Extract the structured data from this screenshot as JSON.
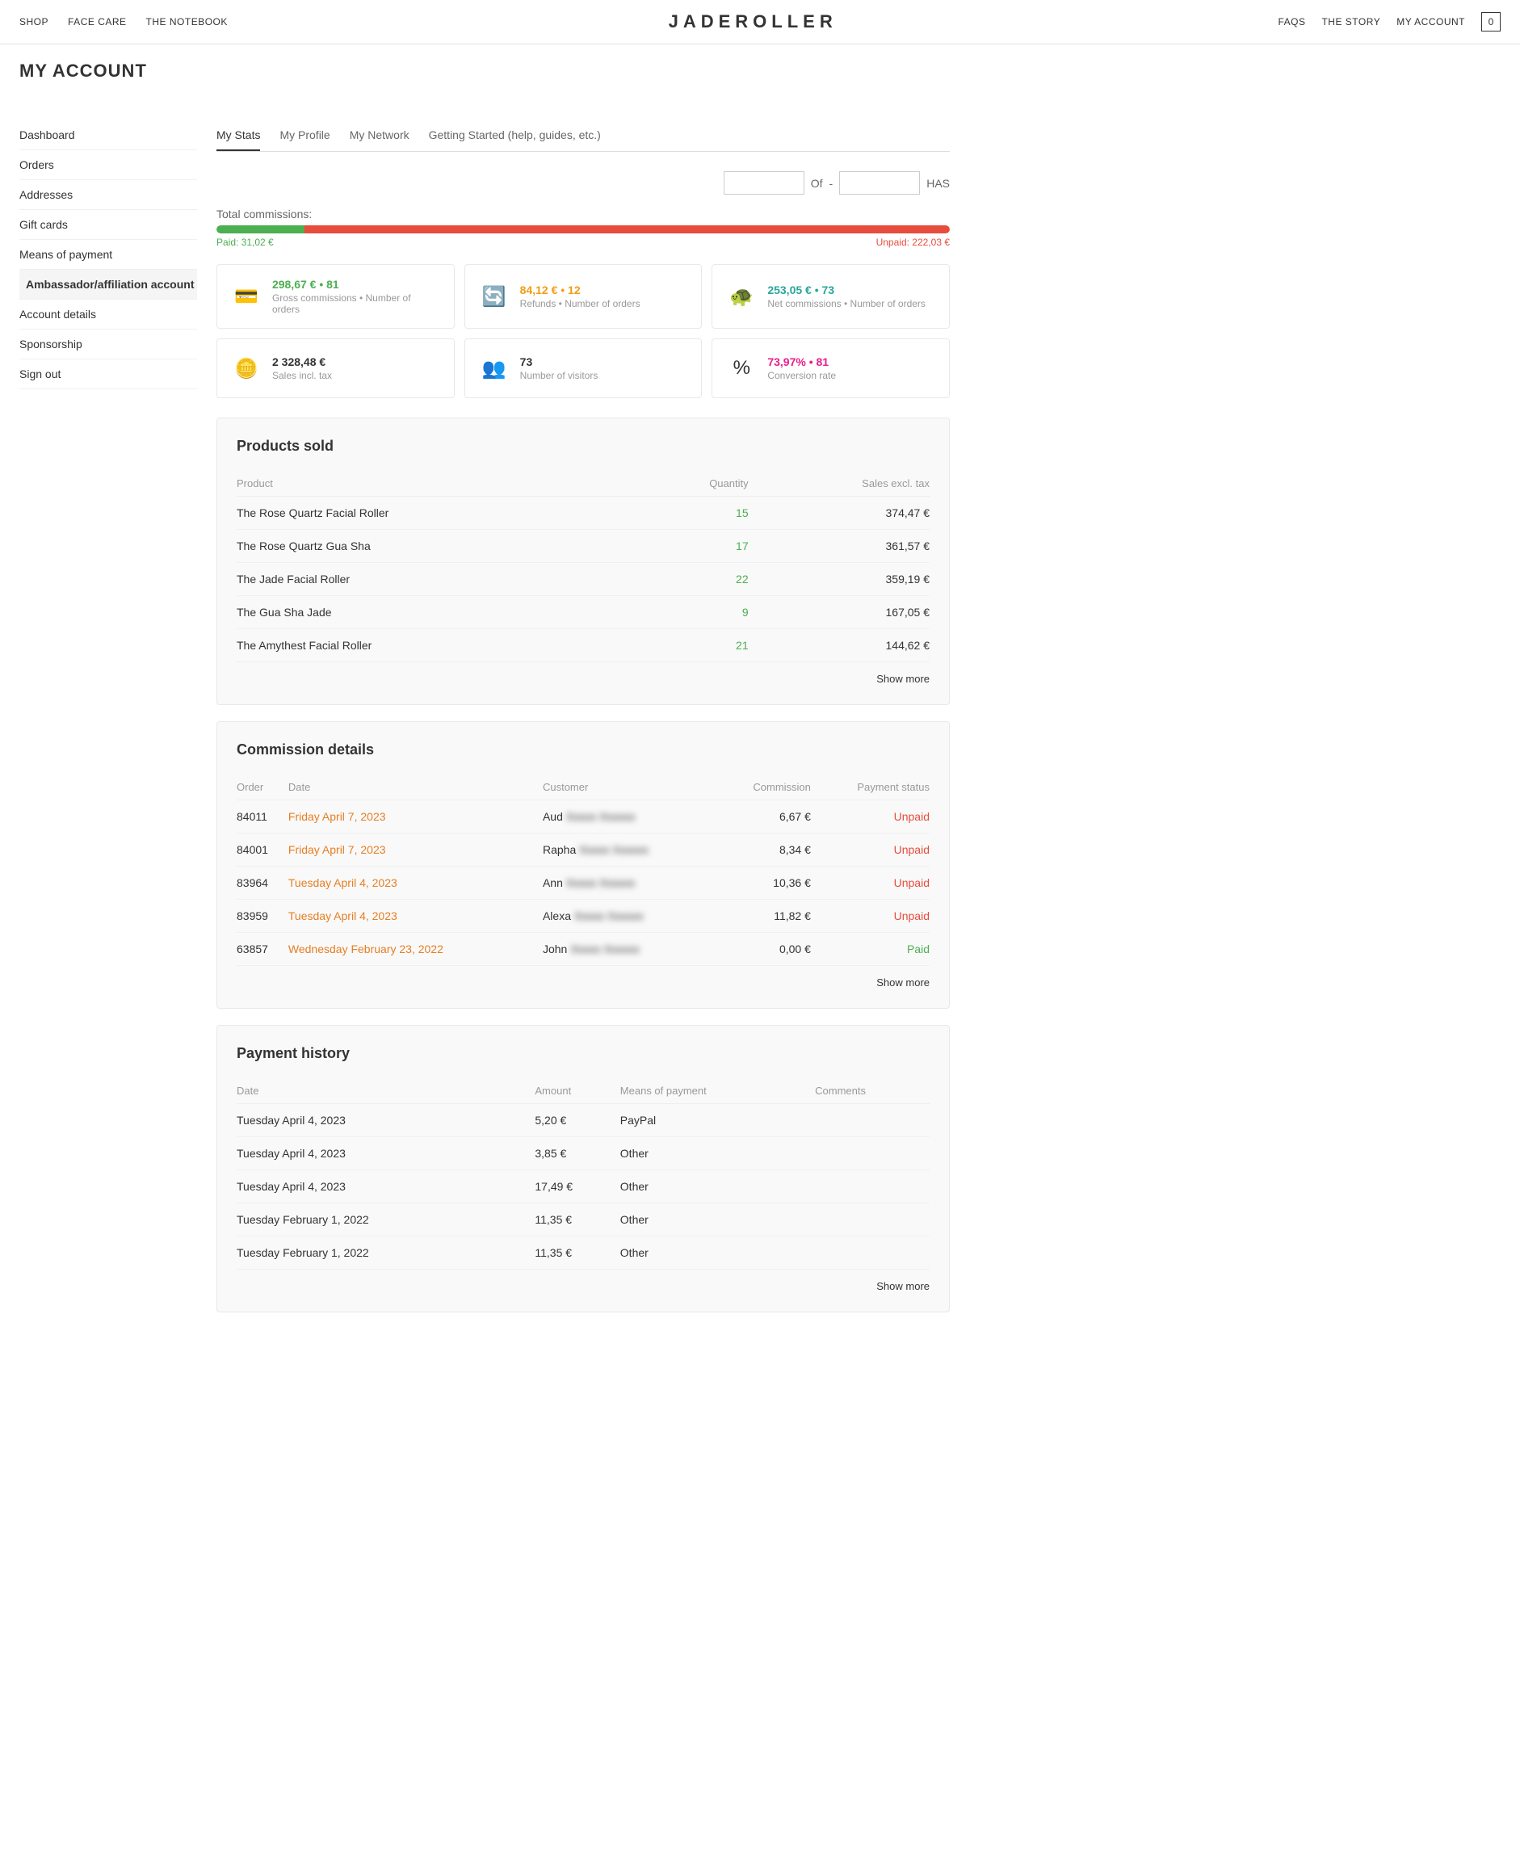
{
  "brand": "JADEROLLER",
  "topnav": {
    "left": [
      "SHOP",
      "FACE CARE",
      "THE NOTEBOOK"
    ],
    "right": [
      "FAQS",
      "THE STORY",
      "MY ACCOUNT"
    ],
    "cart_count": "0"
  },
  "page_title": "MY ACCOUNT",
  "sidebar": {
    "items": [
      {
        "label": "Dashboard",
        "active": false,
        "id": "dashboard"
      },
      {
        "label": "Orders",
        "active": false,
        "id": "orders"
      },
      {
        "label": "Addresses",
        "active": false,
        "id": "addresses"
      },
      {
        "label": "Gift cards",
        "active": false,
        "id": "gift-cards"
      },
      {
        "label": "Means of payment",
        "active": false,
        "id": "means-of-payment"
      },
      {
        "label": "Ambassador/affiliation account",
        "active": true,
        "id": "ambassador"
      },
      {
        "label": "Account details",
        "active": false,
        "id": "account-details"
      },
      {
        "label": "Sponsorship",
        "active": false,
        "id": "sponsorship"
      },
      {
        "label": "Sign out",
        "active": false,
        "id": "sign-out"
      }
    ]
  },
  "tabs": [
    {
      "label": "My Stats",
      "active": true
    },
    {
      "label": "My Profile",
      "active": false
    },
    {
      "label": "My Network",
      "active": false
    },
    {
      "label": "Getting Started (help, guides, etc.)",
      "active": false
    }
  ],
  "filter": {
    "of_label": "Of",
    "dash": "-",
    "has_label": "HAS"
  },
  "commissions": {
    "label": "Total commissions:",
    "paid_label": "Paid: 31,02 €",
    "unpaid_label": "Unpaid: 222,03 €",
    "paid_percent": 12,
    "unpaid_percent": 88
  },
  "stat_cards": [
    {
      "icon": "💳",
      "value": "298,67 € • 81",
      "value_class": "green",
      "label": "Gross commissions • Number of orders"
    },
    {
      "icon": "🔄",
      "value": "84,12 € • 12",
      "value_class": "orange",
      "label": "Refunds • Number of orders"
    },
    {
      "icon": "🐢",
      "value": "253,05 € • 73",
      "value_class": "blue-green",
      "label": "Net commissions • Number of orders"
    },
    {
      "icon": "🪙",
      "value": "2 328,48 €",
      "value_class": "",
      "label": "Sales incl. tax"
    },
    {
      "icon": "👥",
      "value": "73",
      "value_class": "",
      "label": "Number of visitors"
    },
    {
      "icon": "%",
      "value": "73,97% • 81",
      "value_class": "pink",
      "label": "Conversion rate"
    }
  ],
  "products_sold": {
    "title": "Products sold",
    "headers": [
      "Product",
      "Quantity",
      "Sales excl. tax"
    ],
    "rows": [
      {
        "product": "The Rose Quartz Facial Roller",
        "quantity": "15",
        "sales": "374,47 €"
      },
      {
        "product": "The Rose Quartz Gua Sha",
        "quantity": "17",
        "sales": "361,57 €"
      },
      {
        "product": "The Jade Facial Roller",
        "quantity": "22",
        "sales": "359,19 €"
      },
      {
        "product": "The Gua Sha Jade",
        "quantity": "9",
        "sales": "167,05 €"
      },
      {
        "product": "The Amythest Facial Roller",
        "quantity": "21",
        "sales": "144,62 €"
      }
    ],
    "show_more": "Show more"
  },
  "commission_details": {
    "title": "Commission details",
    "headers": [
      "Order",
      "Date",
      "Customer",
      "Commission",
      "Payment status"
    ],
    "rows": [
      {
        "order": "84011",
        "date": "Friday April 7, 2023",
        "customer": "Aud",
        "commission": "6,67 €",
        "status": "Unpaid",
        "status_class": "unpaid"
      },
      {
        "order": "84001",
        "date": "Friday April 7, 2023",
        "customer": "Rapha",
        "commission": "8,34 €",
        "status": "Unpaid",
        "status_class": "unpaid"
      },
      {
        "order": "83964",
        "date": "Tuesday April 4, 2023",
        "customer": "Ann",
        "commission": "10,36 €",
        "status": "Unpaid",
        "status_class": "unpaid"
      },
      {
        "order": "83959",
        "date": "Tuesday April 4, 2023",
        "customer": "Alexa",
        "commission": "11,82 €",
        "status": "Unpaid",
        "status_class": "unpaid"
      },
      {
        "order": "63857",
        "date": "Wednesday February 23, 2022",
        "customer": "John",
        "commission": "0,00 €",
        "status": "Paid",
        "status_class": "paid-status"
      }
    ],
    "show_more": "Show more"
  },
  "payment_history": {
    "title": "Payment history",
    "headers": [
      "Date",
      "Amount",
      "Means of payment",
      "Comments"
    ],
    "rows": [
      {
        "date": "Tuesday April 4, 2023",
        "amount": "5,20 €",
        "means": "PayPal",
        "comments": ""
      },
      {
        "date": "Tuesday April 4, 2023",
        "amount": "3,85 €",
        "means": "Other",
        "comments": ""
      },
      {
        "date": "Tuesday April 4, 2023",
        "amount": "17,49 €",
        "means": "Other",
        "comments": ""
      },
      {
        "date": "Tuesday February 1, 2022",
        "amount": "11,35 €",
        "means": "Other",
        "comments": ""
      },
      {
        "date": "Tuesday February 1, 2022",
        "amount": "11,35 €",
        "means": "Other",
        "comments": ""
      }
    ],
    "show_more": "Show more"
  }
}
